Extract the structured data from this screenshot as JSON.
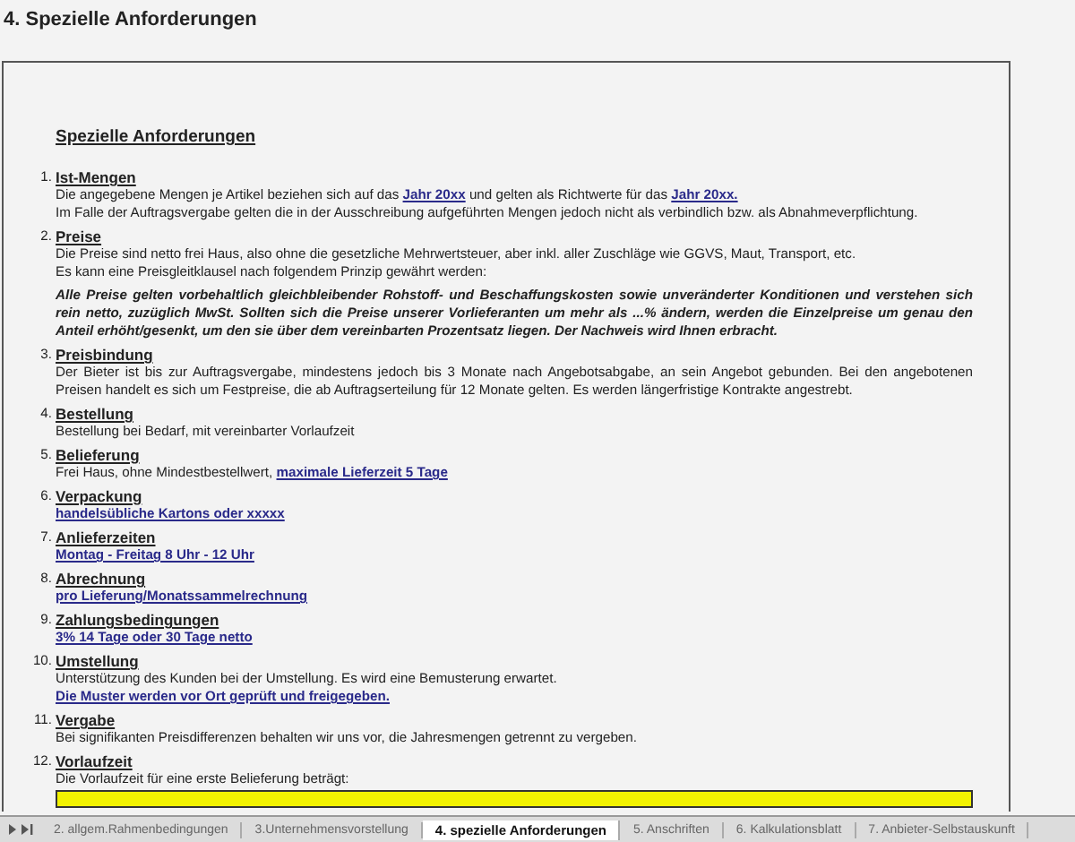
{
  "sheet_title": "4. Spezielle Anforderungen",
  "heading": "Spezielle Anforderungen",
  "items": [
    {
      "number": "1.",
      "title": "Ist-Mengen",
      "lines": [
        {
          "kind": "mixed",
          "parts": [
            {
              "kind": "text",
              "text": "Die angegebene Mengen je Artikel beziehen sich auf das "
            },
            {
              "kind": "link",
              "text": "Jahr 20xx"
            },
            {
              "kind": "text",
              "text": " und gelten als Richtwerte für das "
            },
            {
              "kind": "link",
              "text": "Jahr 20xx."
            }
          ]
        },
        {
          "kind": "text",
          "text": "Im Falle der Auftragsvergabe gelten die in der Ausschreibung aufgeführten Mengen jedoch nicht als verbindlich bzw. als Abnahmeverpflichtung."
        }
      ]
    },
    {
      "number": "2.",
      "title": "Preise",
      "lines": [
        {
          "kind": "text",
          "text": "Die Preise sind netto frei Haus, also ohne die gesetzliche Mehrwertsteuer, aber inkl. aller Zuschläge wie GGVS, Maut, Transport, etc."
        },
        {
          "kind": "text",
          "text": "Es kann eine Preisgleitklausel nach folgendem Prinzip gewährt werden:"
        },
        {
          "kind": "note",
          "text": "Alle Preise gelten vorbehaltlich gleichbleibender Rohstoff- und Beschaffungskosten sowie unveränderter Konditionen und verstehen sich rein netto, zuzüglich MwSt. Sollten sich die Preise unserer Vorlieferanten um mehr als ...% ändern, werden die Einzelpreise um genau den Anteil erhöht/gesenkt, um den sie über dem vereinbarten Prozentsatz liegen. Der Nachweis wird Ihnen erbracht."
        }
      ]
    },
    {
      "number": "3.",
      "title": "Preisbindung",
      "lines": [
        {
          "kind": "justified",
          "text": "Der Bieter ist bis zur Auftragsvergabe, mindestens jedoch bis 3 Monate nach Angebotsabgabe, an sein Angebot gebunden. Bei den angebotenen Preisen handelt es sich um Festpreise, die ab Auftragserteilung für 12 Monate gelten. Es werden längerfristige Kontrakte angestrebt."
        }
      ]
    },
    {
      "number": "4.",
      "title": "Bestellung",
      "lines": [
        {
          "kind": "text",
          "text": "Bestellung bei Bedarf, mit vereinbarter Vorlaufzeit"
        }
      ]
    },
    {
      "number": "5.",
      "title": "Belieferung",
      "lines": [
        {
          "kind": "mixed",
          "parts": [
            {
              "kind": "text",
              "text": "Frei Haus, ohne Mindestbestellwert, "
            },
            {
              "kind": "link",
              "text": "maximale Lieferzeit 5 Tage"
            }
          ]
        }
      ]
    },
    {
      "number": "6.",
      "title": "Verpackung",
      "lines": [
        {
          "kind": "link",
          "text": "handelsübliche Kartons oder xxxxx"
        }
      ]
    },
    {
      "number": "7.",
      "title": "Anlieferzeiten",
      "lines": [
        {
          "kind": "link",
          "text": "Montag - Freitag 8 Uhr - 12 Uhr"
        }
      ]
    },
    {
      "number": "8.",
      "title": "Abrechnung",
      "lines": [
        {
          "kind": "link",
          "text": "pro Lieferung/Monatssammelrechnung"
        }
      ]
    },
    {
      "number": "9.",
      "title": "Zahlungsbedingungen",
      "lines": [
        {
          "kind": "link",
          "text": "3% 14 Tage oder 30 Tage netto"
        }
      ]
    },
    {
      "number": "10.",
      "title": "Umstellung",
      "lines": [
        {
          "kind": "text",
          "text": "Unterstützung des Kunden bei der Umstellung. Es wird eine Bemusterung erwartet."
        },
        {
          "kind": "link",
          "text": "Die Muster werden vor Ort geprüft und freigegeben."
        }
      ]
    },
    {
      "number": "11.",
      "title": "Vergabe",
      "lines": [
        {
          "kind": "text",
          "text": "Bei signifikanten Preisdifferenzen behalten wir uns vor, die Jahresmengen getrennt zu vergeben."
        }
      ]
    },
    {
      "number": "12.",
      "title": "Vorlaufzeit",
      "lines": [
        {
          "kind": "text",
          "text": "Die Vorlaufzeit für eine erste Belieferung beträgt:"
        },
        {
          "kind": "field"
        }
      ]
    }
  ],
  "sheet_tabs": [
    {
      "label": "2. allgem.Rahmenbedingungen",
      "selected": false
    },
    {
      "label": "3.Unternehmensvorstellung",
      "selected": false
    },
    {
      "label": "4. spezielle Anforderungen",
      "selected": true
    },
    {
      "label": "5. Anschriften",
      "selected": false
    },
    {
      "label": "6. Kalkulationsblatt",
      "selected": false
    },
    {
      "label": "7. Anbieter-Selbstauskunft",
      "selected": false
    }
  ]
}
